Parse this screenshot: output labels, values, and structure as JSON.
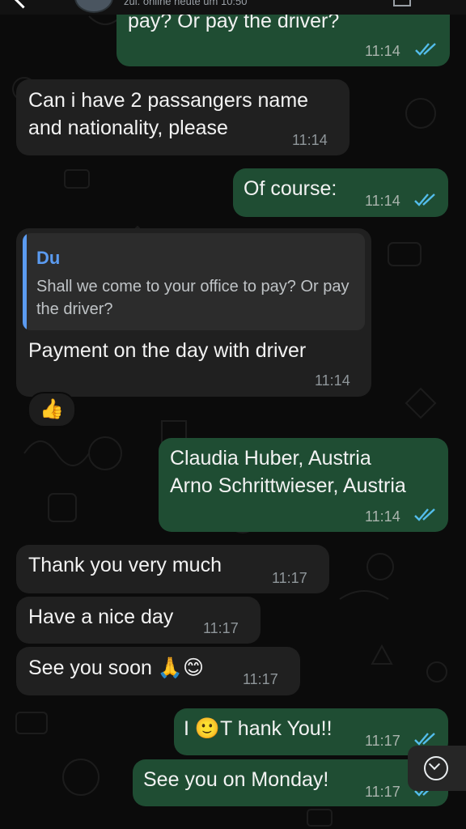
{
  "header": {
    "status_text": "zul. online heute um 10:50"
  },
  "messages": [
    {
      "id": "m1",
      "dir": "out",
      "text": "pay? Or pay the driver?",
      "time": "11:14",
      "read": true
    },
    {
      "id": "m2",
      "dir": "in",
      "lines": [
        "Can i have 2 passangers name",
        "and nationality, please"
      ],
      "time": "11:14"
    },
    {
      "id": "m3",
      "dir": "out",
      "text": "Of course:",
      "time": "11:14",
      "read": true
    },
    {
      "id": "m4",
      "dir": "in",
      "quote": {
        "author": "Du",
        "text": "Shall we come to your office to pay? Or pay the driver?"
      },
      "text": "Payment on the day with driver",
      "time": "11:14",
      "reaction": "👍"
    },
    {
      "id": "m5",
      "dir": "out",
      "lines": [
        "Claudia Huber, Austria",
        "Arno Schrittwieser, Austria"
      ],
      "time": "11:14",
      "read": true
    },
    {
      "id": "m6",
      "dir": "in",
      "text": "Thank you very much",
      "time": "11:17"
    },
    {
      "id": "m7",
      "dir": "in",
      "text": "Have a nice day",
      "time": "11:17"
    },
    {
      "id": "m8",
      "dir": "in",
      "text": "See you soon 🙏😊",
      "time": "11:17"
    },
    {
      "id": "m9",
      "dir": "out",
      "text": "I 🙂T hank You!!",
      "time": "11:17",
      "read": true
    },
    {
      "id": "m10",
      "dir": "out",
      "text": "See you on Monday!",
      "time": "11:17",
      "read": true
    }
  ],
  "colors": {
    "background": "#0b0b0b",
    "outgoing_bubble": "#1f4d33",
    "incoming_bubble": "#202020",
    "read_ticks": "#53bdeb",
    "quote_accent": "#5b9bf0"
  },
  "icons": {
    "back": "chevron-left-icon",
    "read_receipt": "double-check-icon",
    "scroll_down": "chevron-down-circle-icon"
  }
}
